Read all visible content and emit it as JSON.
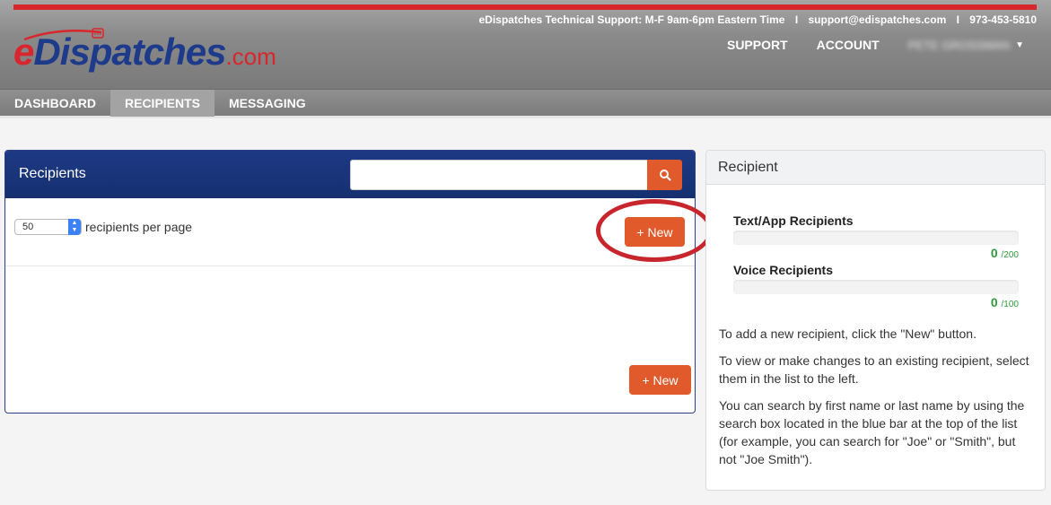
{
  "header": {
    "support_text": "eDispatches Technical Support: M-F 9am-6pm Eastern Time",
    "support_email": "support@edispatches.com",
    "support_phone": "973-453-5810",
    "separator": "I",
    "logo": {
      "e": "e",
      "main": "Dispatches",
      "com": ".com"
    },
    "top_nav": {
      "support": "SUPPORT",
      "account": "ACCOUNT",
      "user_name": "PETE GROSSMAN"
    },
    "accent_color": "#d9262c",
    "brand_color": "#1e3a8a"
  },
  "main_nav": {
    "tabs": [
      {
        "label": "DASHBOARD",
        "active": false
      },
      {
        "label": "RECIPIENTS",
        "active": true
      },
      {
        "label": "MESSAGING",
        "active": false
      }
    ]
  },
  "recipients_panel": {
    "title": "Recipients",
    "search": {
      "placeholder": "",
      "value": "",
      "icon": "search-icon"
    },
    "per_page": {
      "value": "50",
      "label": "recipients per page"
    },
    "new_button_label": "+ New",
    "button_color": "#e05a2b"
  },
  "recipient_panel": {
    "title": "Recipient",
    "quotas": [
      {
        "label": "Text/App Recipients",
        "count": "0",
        "max": "/200",
        "fill": 0
      },
      {
        "label": "Voice Recipients",
        "count": "0",
        "max": "/100",
        "fill": 0
      }
    ],
    "help": [
      "To add a new recipient, click the \"New\" button.",
      "To view or make changes to an existing recipient, select them in the list to the left.",
      "You can search by first name or last name by using the search box located in the blue bar at the top of the list (for example, you can search for \"Joe\" or \"Smith\", but not \"Joe Smith\")."
    ]
  }
}
